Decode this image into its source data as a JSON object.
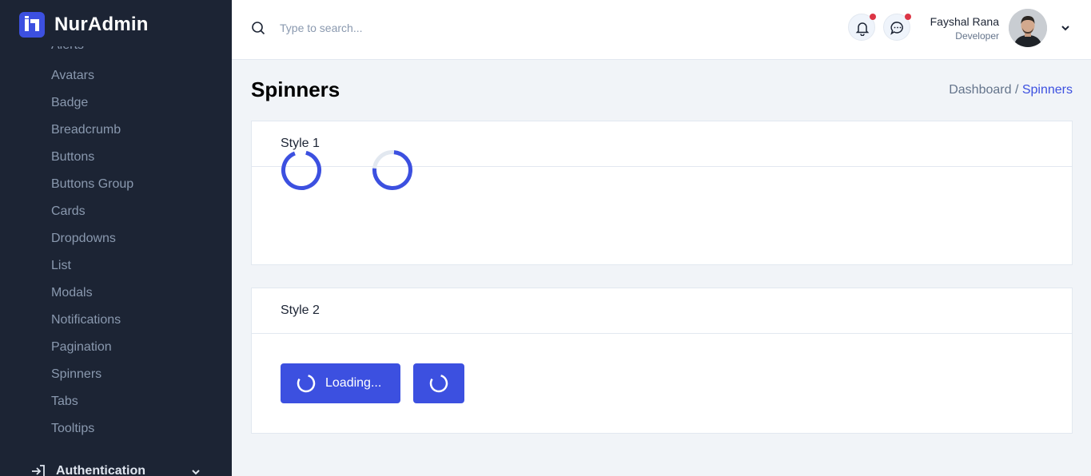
{
  "brand": {
    "name": "NurAdmin"
  },
  "sidebar": {
    "items": [
      "Avatars",
      "Badge",
      "Breadcrumb",
      "Buttons",
      "Buttons Group",
      "Cards",
      "Dropdowns",
      "List",
      "Modals",
      "Notifications",
      "Pagination",
      "Spinners",
      "Tabs",
      "Tooltips"
    ],
    "cut_off_item": "Alerts",
    "auth_label": "Authentication"
  },
  "search": {
    "placeholder": "Type to search..."
  },
  "user": {
    "name": "Fayshal Rana",
    "role": "Developer"
  },
  "page": {
    "title": "Spinners"
  },
  "breadcrumb": {
    "parent": "Dashboard /",
    "current": "Spinners"
  },
  "cards": {
    "style1": {
      "title": "Style 1"
    },
    "style2": {
      "title": "Style 2",
      "loading_label": "Loading..."
    }
  },
  "colors": {
    "primary": "#3c50e0",
    "sidebar_bg": "#1c2434",
    "badge_dot": "#dc3545"
  },
  "icons": {
    "brand": "brand-logo-icon",
    "search": "search-icon",
    "notifications": "bell-icon",
    "messages": "chat-icon",
    "user_menu": "chevron-down-icon",
    "auth": "login-icon"
  }
}
